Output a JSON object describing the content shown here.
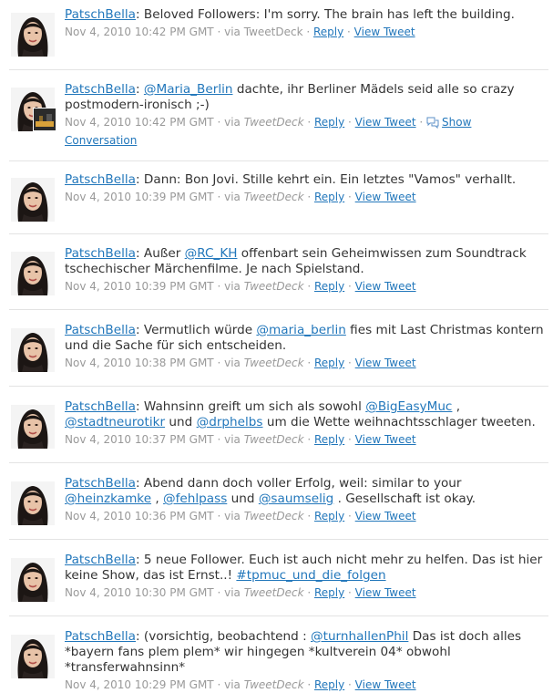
{
  "colors": {
    "link": "#2277bb",
    "meta": "#999999",
    "text": "#333333",
    "divider": "#e3e3e3"
  },
  "labels": {
    "reply": "Reply",
    "view_tweet": "View Tweet",
    "show": "Show",
    "conversation": "Conversation",
    "via": "via"
  },
  "tweets": [
    {
      "user": "PatschBella",
      "user_linked": false,
      "parts": [
        {
          "t": "Beloved Followers: I'm sorry. The brain has left the building."
        }
      ],
      "timestamp": "Nov 4, 2010 10:42 PM GMT",
      "source": "TweetDeck",
      "source_italic": false,
      "show_conversation": false
    },
    {
      "user": "PatschBella",
      "user_linked": true,
      "parts": [
        {
          "m": "@Maria_Berlin"
        },
        {
          "t": " dachte, ihr Berliner Mädels seid alle so crazy postmodern-ironisch ;-)"
        }
      ],
      "timestamp": "Nov 4, 2010 10:42 PM GMT",
      "source": "TweetDeck",
      "source_italic": true,
      "show_conversation": true
    },
    {
      "user": "PatschBella",
      "user_linked": true,
      "parts": [
        {
          "t": "Dann: Bon Jovi. Stille kehrt ein. Ein letztes \"Vamos\" verhallt."
        }
      ],
      "timestamp": "Nov 4, 2010 10:39 PM GMT",
      "source": "TweetDeck",
      "source_italic": true,
      "show_conversation": false
    },
    {
      "user": "PatschBella",
      "user_linked": true,
      "parts": [
        {
          "t": "Außer "
        },
        {
          "m": "@RC_KH"
        },
        {
          "t": " offenbart sein Geheimwissen zum Soundtrack tschechischer Märchenfilme. Je nach Spielstand."
        }
      ],
      "timestamp": "Nov 4, 2010 10:39 PM GMT",
      "source": "TweetDeck",
      "source_italic": true,
      "show_conversation": false
    },
    {
      "user": "PatschBella",
      "user_linked": true,
      "parts": [
        {
          "t": "Vermutlich würde "
        },
        {
          "m": "@maria_berlin"
        },
        {
          "t": " fies mit Last Christmas kontern und die Sache für sich entscheiden."
        }
      ],
      "timestamp": "Nov 4, 2010 10:38 PM GMT",
      "source": "TweetDeck",
      "source_italic": true,
      "show_conversation": false
    },
    {
      "user": "PatschBella",
      "user_linked": true,
      "parts": [
        {
          "t": "Wahnsinn greift um sich als sowohl "
        },
        {
          "m": "@BigEasyMuc"
        },
        {
          "t": " , "
        },
        {
          "m": "@stadtneurotikr"
        },
        {
          "t": " und "
        },
        {
          "m": "@drphelbs"
        },
        {
          "t": " um die Wette weihnachtsschlager tweeten."
        }
      ],
      "timestamp": "Nov 4, 2010 10:37 PM GMT",
      "source": "TweetDeck",
      "source_italic": true,
      "show_conversation": false
    },
    {
      "user": "PatschBella",
      "user_linked": true,
      "parts": [
        {
          "t": "Abend dann doch voller Erfolg, weil: similar to your "
        },
        {
          "m": "@heinzkamke"
        },
        {
          "t": " , "
        },
        {
          "m": "@fehlpass"
        },
        {
          "t": " und "
        },
        {
          "m": "@saumselig"
        },
        {
          "t": " . Gesellschaft ist okay."
        }
      ],
      "timestamp": "Nov 4, 2010 10:36 PM GMT",
      "source": "TweetDeck",
      "source_italic": true,
      "show_conversation": false
    },
    {
      "user": "PatschBella",
      "user_linked": true,
      "parts": [
        {
          "t": "5 neue Follower. Euch ist auch nicht mehr zu helfen. Das ist hier keine Show, das ist Ernst..! "
        },
        {
          "m": "#tpmuc_und_die_folgen"
        }
      ],
      "timestamp": "Nov 4, 2010 10:30 PM GMT",
      "source": "TweetDeck",
      "source_italic": true,
      "show_conversation": false
    },
    {
      "user": "PatschBella",
      "user_linked": true,
      "parts": [
        {
          "t": "(vorsichtig, beobachtend : "
        },
        {
          "m": "@turnhallenPhil"
        },
        {
          "t": " Das ist doch alles *bayern fans plem plem* wir hingegen *kultverein 04* obwohl *transferwahnsinn*"
        }
      ],
      "timestamp": "Nov 4, 2010 10:29 PM GMT",
      "source": "TweetDeck",
      "source_italic": true,
      "show_conversation": false
    }
  ]
}
